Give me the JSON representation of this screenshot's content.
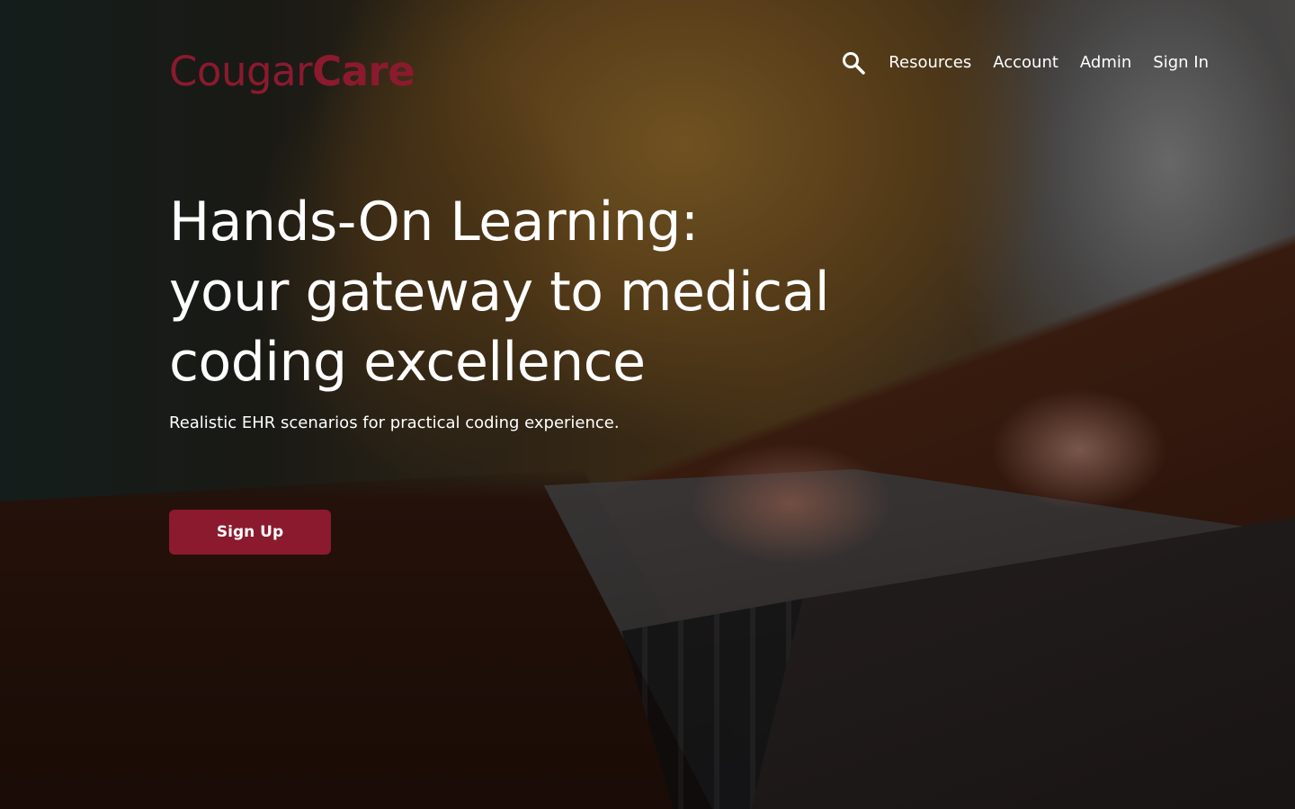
{
  "brand": {
    "name_light": "Cougar",
    "name_bold": "Care",
    "color": "#8b1a2e"
  },
  "nav": {
    "search_icon": "search-icon",
    "items": [
      {
        "label": "Resources"
      },
      {
        "label": "Account"
      },
      {
        "label": "Admin"
      },
      {
        "label": "Sign In"
      }
    ]
  },
  "hero": {
    "headline_lines": [
      "Hands-On Learning:",
      "your gateway to medical",
      "coding excellence"
    ],
    "subtitle": "Realistic EHR scenarios for practical coding experience.",
    "cta_label": "Sign Up",
    "cta_color": "#8b1a2e"
  }
}
